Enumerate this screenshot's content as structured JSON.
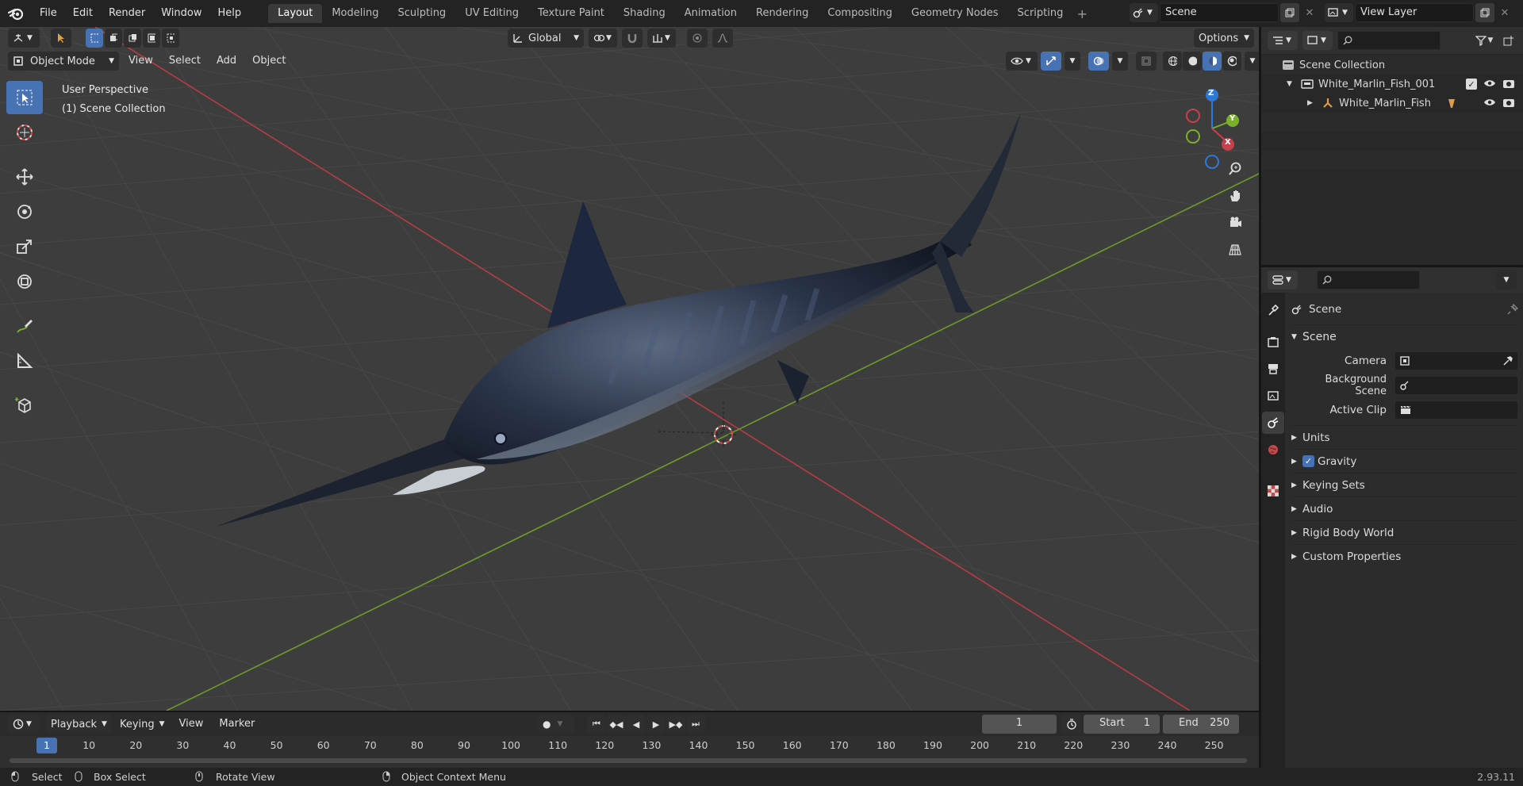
{
  "top_menu": [
    "File",
    "Edit",
    "Render",
    "Window",
    "Help"
  ],
  "workspaces": [
    "Layout",
    "Modeling",
    "Sculpting",
    "UV Editing",
    "Texture Paint",
    "Shading",
    "Animation",
    "Rendering",
    "Compositing",
    "Geometry Nodes",
    "Scripting"
  ],
  "active_workspace": "Layout",
  "scene_name": "Scene",
  "view_layer": "View Layer",
  "viewport": {
    "mode": "Object Mode",
    "menus": [
      "View",
      "Select",
      "Add",
      "Object"
    ],
    "orientation": "Global",
    "options_label": "Options",
    "overlay_line1": "User Perspective",
    "overlay_line2": "(1) Scene Collection",
    "gizmo": {
      "z": "Z",
      "y": "Y",
      "x": "X"
    }
  },
  "outliner": {
    "root": "Scene Collection",
    "collection": "White_Marlin_Fish_001",
    "object": "White_Marlin_Fish"
  },
  "properties": {
    "context_title": "Scene",
    "panel_title": "Scene",
    "camera_label": "Camera",
    "background_scene_label": "Background Scene",
    "active_clip_label": "Active Clip",
    "sections": [
      "Units",
      "Gravity",
      "Keying Sets",
      "Audio",
      "Rigid Body World",
      "Custom Properties"
    ],
    "gravity_checked": true
  },
  "timeline": {
    "menus": [
      "Playback",
      "Keying",
      "View",
      "Marker"
    ],
    "current_frame": "1",
    "start_label": "Start",
    "start_value": "1",
    "end_label": "End",
    "end_value": "250",
    "ticks": [
      "1",
      "10",
      "20",
      "30",
      "40",
      "50",
      "60",
      "70",
      "80",
      "90",
      "100",
      "110",
      "120",
      "130",
      "140",
      "150",
      "160",
      "170",
      "180",
      "190",
      "200",
      "210",
      "220",
      "230",
      "240",
      "250"
    ]
  },
  "statusbar": {
    "select": "Select",
    "box_select": "Box Select",
    "rotate_view": "Rotate View",
    "context_menu": "Object Context Menu",
    "version": "2.93.11"
  },
  "colors": {
    "accent": "#4772b3",
    "x_axis": "#c8404a",
    "y_axis": "#7ab02b",
    "z_axis": "#2f79d6"
  }
}
